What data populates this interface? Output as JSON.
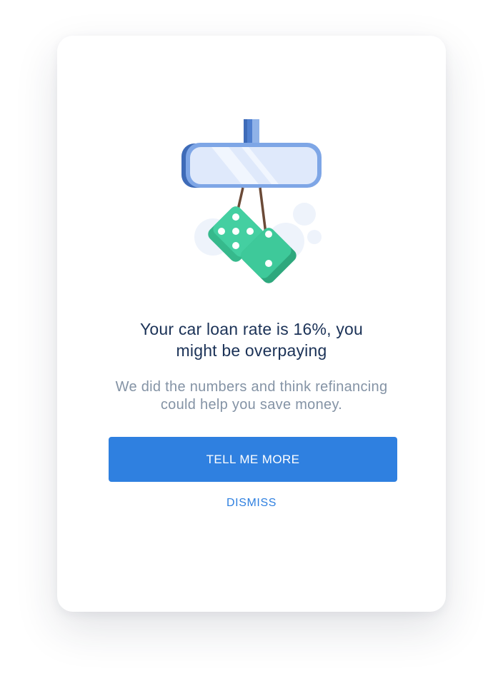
{
  "dialog": {
    "headline_line1": "Your car loan rate is 16%, you",
    "headline_line2": "might be overpaying",
    "subtext_line1": "We did the numbers and think refinancing",
    "subtext_line2": "could help you save money.",
    "primary_button_label": "TELL ME MORE",
    "dismiss_label": "DISMISS"
  },
  "illustration": {
    "icon": "rearview-mirror-with-fuzzy-dice-icon"
  },
  "colors": {
    "accent": "#2f80e0",
    "headline": "#1b3257",
    "subtext": "#8493a5",
    "dice": "#3ec99a",
    "mirror": "#5b8fd6"
  }
}
